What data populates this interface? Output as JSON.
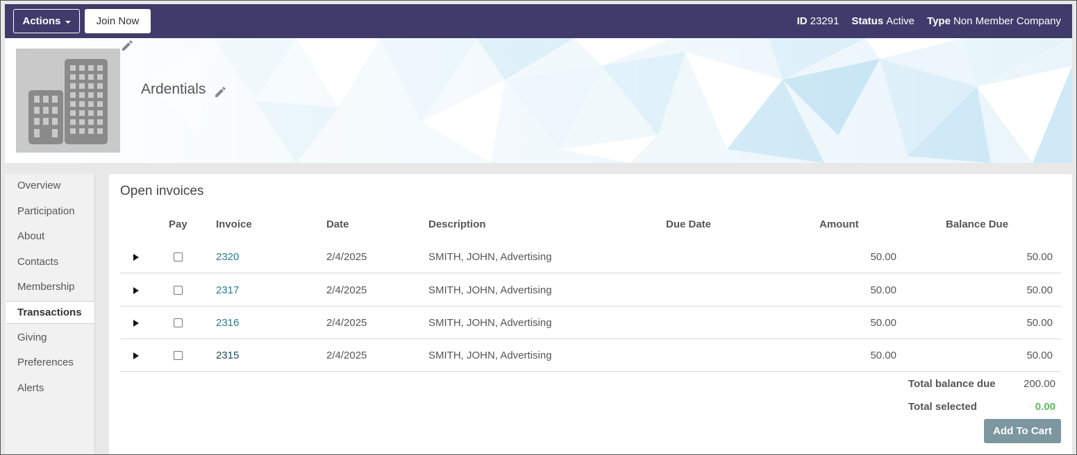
{
  "header": {
    "actions_label": "Actions",
    "join_label": "Join Now",
    "id_label": "ID",
    "id_value": "23291",
    "status_label": "Status",
    "status_value": "Active",
    "type_label": "Type",
    "type_value": "Non Member Company"
  },
  "profile": {
    "name": "Ardentials"
  },
  "sidebar": {
    "items": [
      {
        "label": "Overview"
      },
      {
        "label": "Participation"
      },
      {
        "label": "About"
      },
      {
        "label": "Contacts"
      },
      {
        "label": "Membership"
      },
      {
        "label": "Transactions"
      },
      {
        "label": "Giving"
      },
      {
        "label": "Preferences"
      },
      {
        "label": "Alerts"
      }
    ],
    "active": "Transactions"
  },
  "invoices": {
    "title": "Open invoices",
    "columns": {
      "pay": "Pay",
      "invoice": "Invoice",
      "date": "Date",
      "description": "Description",
      "due_date": "Due Date",
      "amount": "Amount",
      "balance_due": "Balance Due"
    },
    "rows": [
      {
        "invoice": "2320",
        "date": "2/4/2025",
        "description": "SMITH, JOHN, Advertising",
        "due_date": "",
        "amount": "50.00",
        "balance": "50.00"
      },
      {
        "invoice": "2317",
        "date": "2/4/2025",
        "description": "SMITH, JOHN, Advertising",
        "due_date": "",
        "amount": "50.00",
        "balance": "50.00"
      },
      {
        "invoice": "2316",
        "date": "2/4/2025",
        "description": "SMITH, JOHN, Advertising",
        "due_date": "",
        "amount": "50.00",
        "balance": "50.00"
      },
      {
        "invoice": "2315",
        "date": "2/4/2025",
        "description": "SMITH, JOHN, Advertising",
        "due_date": "",
        "amount": "50.00",
        "balance": "50.00"
      }
    ],
    "total_balance_label": "Total balance due",
    "total_balance_value": "200.00",
    "total_selected_label": "Total selected",
    "total_selected_value": "0.00",
    "add_to_cart_label": "Add To Cart"
  },
  "colors": {
    "topbar": "#403b6a",
    "link": "#2a7a8c",
    "selected_total": "#5cb85c",
    "cart_button": "#7c979f"
  }
}
